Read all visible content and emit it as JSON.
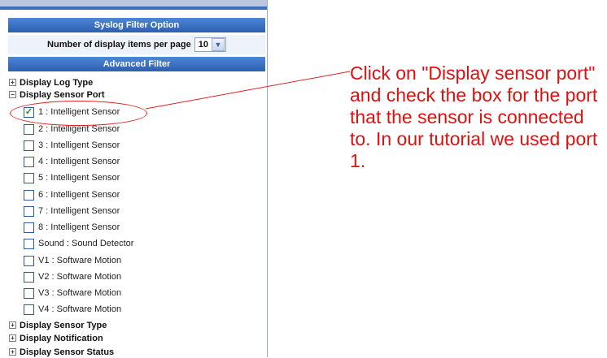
{
  "syslog_filter": {
    "title": "Syslog Filter Option"
  },
  "display_items": {
    "label": "Number of display items per page",
    "value": "10"
  },
  "advanced_filter": {
    "title": "Advanced Filter"
  },
  "tree": {
    "display_log_type": {
      "label": "Display Log Type",
      "toggle": "+"
    },
    "display_sensor_port": {
      "label": "Display Sensor Port",
      "toggle": "−",
      "items": [
        {
          "label": "1 : Intelligent Sensor",
          "checked": true
        },
        {
          "label": "2 : Intelligent Sensor",
          "checked": false
        },
        {
          "label": "3 : Intelligent Sensor",
          "checked": false
        },
        {
          "label": "4 : Intelligent Sensor",
          "checked": false
        },
        {
          "label": "5 : Intelligent Sensor",
          "checked": false
        },
        {
          "label": "6 : Intelligent Sensor",
          "checked": false
        },
        {
          "label": "7 : Intelligent Sensor",
          "checked": false
        },
        {
          "label": "8 : Intelligent Sensor",
          "checked": false
        },
        {
          "label": "Sound : Sound Detector",
          "checked": false
        },
        {
          "label": "V1 : Software Motion",
          "checked": false
        },
        {
          "label": "V2 : Software Motion",
          "checked": false
        },
        {
          "label": "V3 : Software Motion",
          "checked": false
        },
        {
          "label": "V4 : Software Motion",
          "checked": false
        }
      ]
    },
    "display_sensor_type": {
      "label": "Display Sensor Type",
      "toggle": "+"
    },
    "display_notification": {
      "label": "Display Notification",
      "toggle": "+"
    },
    "display_sensor_status": {
      "label": "Display Sensor Status",
      "toggle": "+"
    }
  },
  "annotation": {
    "text": "Click on \"Display sensor port\" and check the box for the port that the sensor is connected to. In our tutorial we used port 1.",
    "color": "#e01010"
  },
  "colors": {
    "header_bar": "#3a6fc4",
    "checkmark": "#1f8a1f"
  }
}
